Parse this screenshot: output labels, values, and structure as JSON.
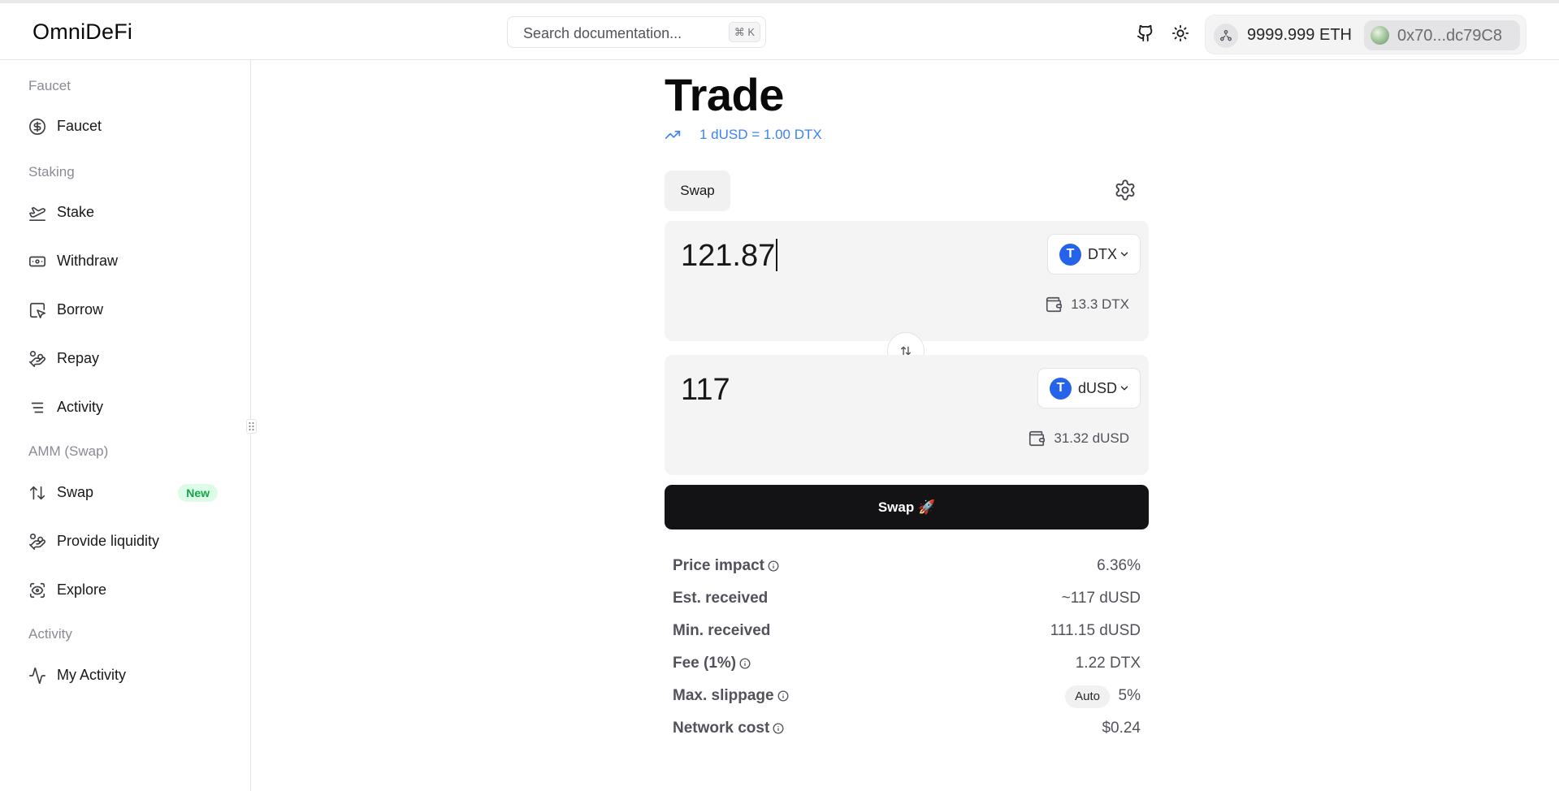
{
  "brand": {
    "name": "OmniDeFi"
  },
  "search": {
    "placeholder": "Search documentation...",
    "shortcut": "⌘ K"
  },
  "header_icons": {
    "github": "github-icon",
    "theme": "sun-icon"
  },
  "wallet": {
    "network_icon": "network-icon",
    "balance": "9999.999 ETH",
    "address": "0x70...dc79C8"
  },
  "sidebar": {
    "sections": {
      "faucet": "Faucet",
      "staking": "Staking",
      "amm": "AMM (Swap)",
      "activity": "Activity"
    },
    "items": {
      "faucet": "Faucet",
      "stake": "Stake",
      "withdraw": "Withdraw",
      "borrow": "Borrow",
      "repay": "Repay",
      "activity": "Activity",
      "swap": "Swap",
      "swap_badge": "New",
      "provide_liquidity": "Provide liquidity",
      "explore": "Explore",
      "my_activity": "My Activity"
    }
  },
  "trade": {
    "title": "Trade",
    "rate": "1 dUSD = 1.00 DTX",
    "tab": "Swap",
    "from": {
      "amount": "121.87",
      "token": "DTX",
      "balance": "13.3 DTX"
    },
    "to": {
      "amount": "117",
      "token": "dUSD",
      "balance": "31.32 dUSD"
    },
    "cta": "Swap 🚀"
  },
  "details": {
    "price_impact": {
      "label": "Price impact",
      "value": "6.36%"
    },
    "est_received": {
      "label": "Est. received",
      "value": "~117 dUSD"
    },
    "min_received": {
      "label": "Min. received",
      "value": "111.15 dUSD"
    },
    "fee": {
      "label": "Fee (1%)",
      "value": "1.22 DTX"
    },
    "max_slippage": {
      "label": "Max. slippage",
      "mode": "Auto",
      "value": "5%"
    },
    "network_cost": {
      "label": "Network cost",
      "value": "$0.24"
    }
  },
  "colors": {
    "accent": "#3b82f6",
    "token_blue": "#2563eb",
    "badge_green": "#16a34a",
    "cta_bg": "#131316"
  }
}
